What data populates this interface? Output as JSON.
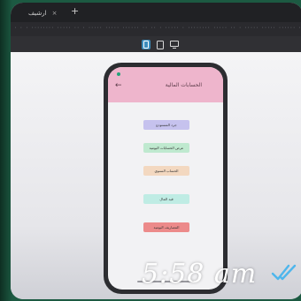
{
  "browser": {
    "tab_title": "ارشيف",
    "tab_close": "×",
    "new_tab": "+",
    "url_text": "· · · ········ ····· ·· · ····· ····· ······ ·· ·· · ····· · ········ ····· ·· · ····· ····· ······ ·· ·· · ····· · ········ ····· ·· · ····· ····· ······ ·· ·· · ·····"
  },
  "devices": {
    "phone": "phone-icon",
    "tablet": "tablet-icon",
    "desktop": "desktop-icon",
    "active_color": "#3c8dbc"
  },
  "app": {
    "back_icon": "back-arrow-icon",
    "back_glyph": "←",
    "title": "الحسابات المالية",
    "appbar_color": "#eeb5cc",
    "buttons": [
      {
        "label": "جرد المستودع",
        "color": "#c6c2ee"
      },
      {
        "label": "عرض الحسابات اليومية",
        "color": "#bfe9cf"
      },
      {
        "label": "الحساب السنوي",
        "color": "#f3d8c0"
      },
      {
        "label": "قيد المال",
        "color": "#bfece4"
      },
      {
        "label": "المصاريف اليومية",
        "color": "#ec8a8a"
      }
    ]
  },
  "overlay": {
    "time": "5:58 am",
    "read_icon": "double-check-icon",
    "read_color": "#4fb6ec"
  }
}
